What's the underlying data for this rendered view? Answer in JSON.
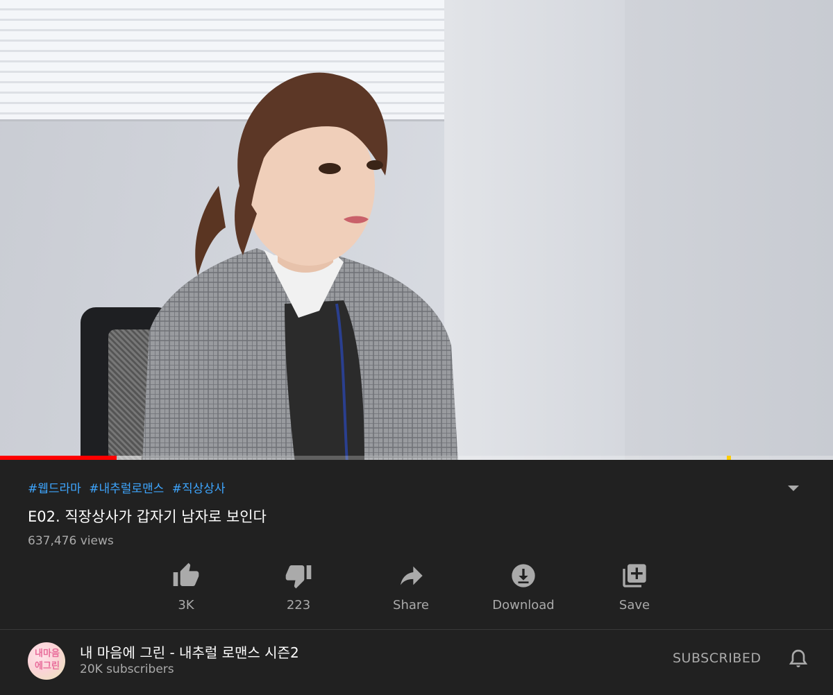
{
  "video": {
    "progress_played": 0.14,
    "progress_buffered": 0.17,
    "accent_color": "#ff0000"
  },
  "tags": [
    "#웹드라마",
    "#내추럴로맨스",
    "#직상상사"
  ],
  "title": "E02. 직장상사가 갑자기 남자로 보인다",
  "views": "637,476 views",
  "actions": {
    "like": {
      "label": "3K",
      "icon": "thumbs-up-icon"
    },
    "dislike": {
      "label": "223",
      "icon": "thumbs-down-icon"
    },
    "share": {
      "label": "Share",
      "icon": "share-icon"
    },
    "download": {
      "label": "Download",
      "icon": "download-icon"
    },
    "save": {
      "label": "Save",
      "icon": "playlist-add-icon"
    }
  },
  "channel": {
    "name": "내 마음에 그린 - 내추럴 로맨스 시즌2",
    "subscribers": "20K subscribers",
    "avatar_text": "내마음에그린",
    "subscribe_label": "SUBSCRIBED"
  }
}
